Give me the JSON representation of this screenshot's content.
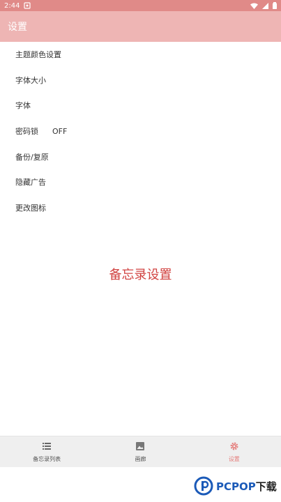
{
  "status_bar": {
    "time": "2:44"
  },
  "app_bar": {
    "title": "设置"
  },
  "settings": {
    "items": [
      {
        "label": "主题颜色设置"
      },
      {
        "label": "字体大小"
      },
      {
        "label": "字体"
      },
      {
        "label": "密码锁",
        "value": "OFF"
      },
      {
        "label": "备份/复原"
      },
      {
        "label": "隐藏广告"
      },
      {
        "label": "更改图标"
      }
    ]
  },
  "center_title": "备忘录设置",
  "bottom_nav": {
    "items": [
      {
        "label": "备忘录列表",
        "icon": "list-icon"
      },
      {
        "label": "画廊",
        "icon": "image-icon"
      },
      {
        "label": "设置",
        "icon": "gear-icon",
        "active": true
      }
    ],
    "active_color": "#e57f7d"
  },
  "colors": {
    "status_bar": "#e08a88",
    "app_bar": "#eeb5b4",
    "title_red": "#d14240"
  },
  "watermark": {
    "brand": "PCPOP",
    "suffix": "下载"
  }
}
